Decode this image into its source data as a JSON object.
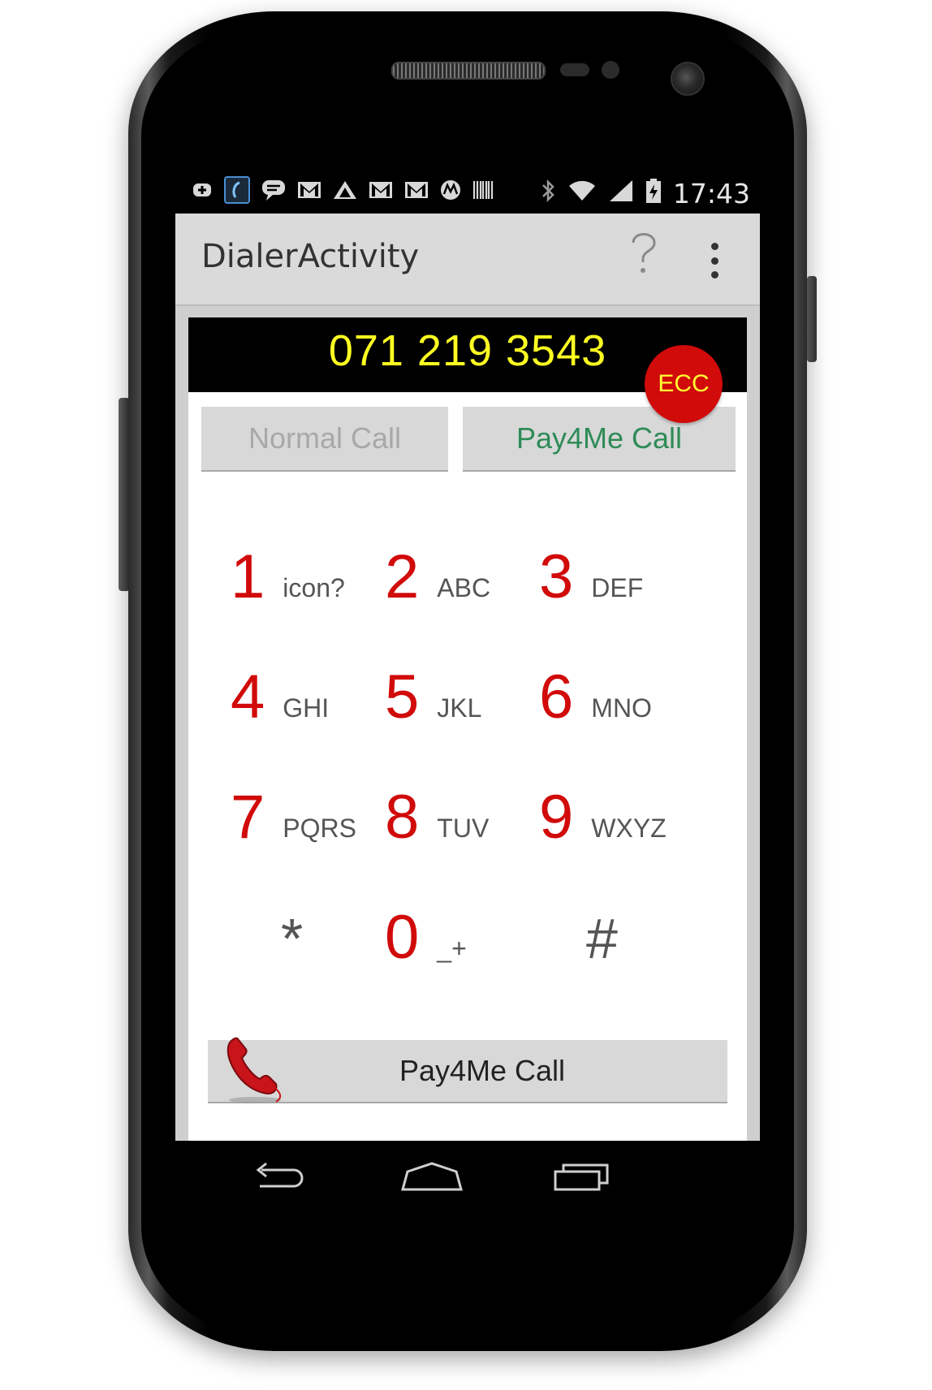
{
  "status_bar": {
    "notification_icons": [
      "plus-box-icon",
      "phone-app-icon",
      "chat-bubble-icon",
      "gmail-icon",
      "triangle-logo-icon",
      "gmail-icon",
      "gmail-icon",
      "motorola-icon",
      "barcode-icon"
    ],
    "system_icons": [
      "bluetooth-icon",
      "wifi-icon",
      "signal-icon",
      "battery-charging-icon"
    ],
    "time": "17:43"
  },
  "action_bar": {
    "title": "DialerActivity",
    "help_icon": "question-icon",
    "menu_icon": "overflow-menu-icon"
  },
  "display": {
    "number": "071 219 3543",
    "badge": "ECC"
  },
  "mode_buttons": {
    "normal_call": "Normal Call",
    "pay4me_call": "Pay4Me Call"
  },
  "keypad": [
    {
      "digit": "1",
      "letters": "icon?"
    },
    {
      "digit": "2",
      "letters": "ABC"
    },
    {
      "digit": "3",
      "letters": "DEF"
    },
    {
      "digit": "4",
      "letters": "GHI"
    },
    {
      "digit": "5",
      "letters": "JKL"
    },
    {
      "digit": "6",
      "letters": "MNO"
    },
    {
      "digit": "7",
      "letters": "PQRS"
    },
    {
      "digit": "8",
      "letters": "TUV"
    },
    {
      "digit": "9",
      "letters": "WXYZ"
    },
    {
      "digit": "*",
      "letters": ""
    },
    {
      "digit": "0",
      "letters": "_+"
    },
    {
      "digit": "#",
      "letters": ""
    }
  ],
  "call_button": {
    "label": "Pay4Me Call",
    "icon": "phone-handset-icon"
  },
  "colors": {
    "accent_red": "#d10a0a",
    "number_yellow": "#ffff22",
    "pay4me_green": "#2e8b57"
  },
  "nav_bar": {
    "icons": [
      "back-icon",
      "home-icon",
      "recent-apps-icon"
    ]
  }
}
